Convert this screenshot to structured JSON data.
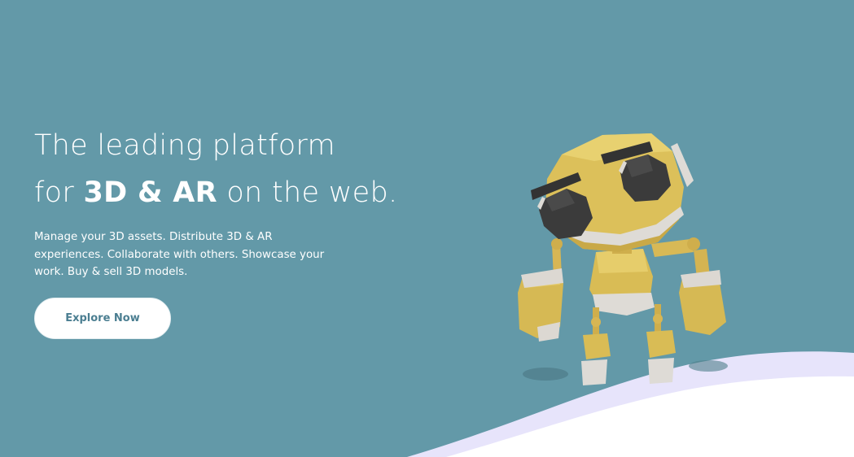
{
  "hero": {
    "headline_line1": "The leading platform",
    "headline_line2_prefix": "for ",
    "headline_line2_bold": "3D & AR",
    "headline_line2_suffix": " on the web.",
    "description": "Manage your 3D assets. Distribute 3D & AR experiences. Collaborate with others. Showcase your work. Buy & sell 3D models.",
    "cta_label": "Explore Now"
  },
  "illustration": {
    "icon": "yellow-robot-illustration"
  },
  "colors": {
    "background": "#6399a8",
    "wave_back": "#e7e4fb",
    "wave_front": "#ffffff",
    "robot_body": "#dcc15c",
    "robot_dark": "#3b3b3b",
    "robot_trim": "#dedbd6",
    "cta_text": "#4b7e91"
  }
}
